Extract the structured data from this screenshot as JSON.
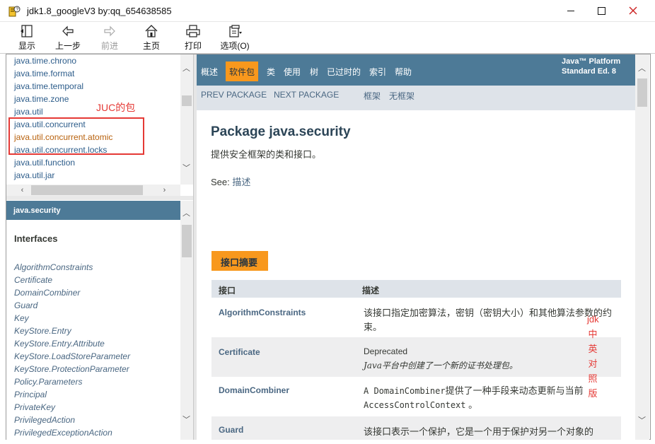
{
  "window": {
    "title": "jdk1.8_googleV3 by:qq_654638585",
    "icon": "chm-help-icon",
    "controls": {
      "minimize": "—",
      "maximize": "☐",
      "close": "✕"
    },
    "close_color": "#cc2222"
  },
  "toolbar": {
    "buttons": [
      {
        "label": "显示",
        "icon": "show-nav-icon",
        "enabled": true
      },
      {
        "label": "上一步",
        "icon": "back-arrow-icon",
        "enabled": true
      },
      {
        "label": "前进",
        "icon": "forward-arrow-icon",
        "enabled": false
      },
      {
        "label": "主页",
        "icon": "home-icon",
        "enabled": true
      },
      {
        "label": "打印",
        "icon": "printer-icon",
        "enabled": true
      },
      {
        "label": "选项(O)",
        "icon": "options-icon",
        "enabled": true
      }
    ]
  },
  "package_list": {
    "items": [
      "java.time.chrono",
      "java.time.format",
      "java.time.temporal",
      "java.time.zone",
      "java.util",
      "java.util.concurrent",
      "java.util.concurrent.atomic",
      "java.util.concurrent.locks",
      "java.util.function",
      "java.util.jar"
    ],
    "highlighted": [
      "java.util.concurrent.atomic"
    ],
    "annotation": "JUC的包"
  },
  "class_pane": {
    "header": "java.security",
    "section": "Interfaces",
    "items": [
      "AlgorithmConstraints",
      "Certificate",
      "DomainCombiner",
      "Guard",
      "Key",
      "KeyStore.Entry",
      "KeyStore.Entry.Attribute",
      "KeyStore.LoadStoreParameter",
      "KeyStore.ProtectionParameter",
      "Policy.Parameters",
      "Principal",
      "PrivateKey",
      "PrivilegedAction",
      "PrivilegedExceptionAction"
    ]
  },
  "content": {
    "top_nav": [
      "概述",
      "软件包",
      "类",
      "使用",
      "树",
      "已过时的",
      "索引",
      "帮助"
    ],
    "active_nav": "软件包",
    "platform_line1": "Java™ Platform",
    "platform_line2": "Standard Ed. 8",
    "sub_nav": [
      "PREV PACKAGE",
      "NEXT PACKAGE",
      "框架",
      "无框架"
    ],
    "package_title": "Package java.security",
    "package_description": "提供安全框架的类和接口。",
    "see_label": "See: ",
    "see_link": "描述",
    "summary_tab": "接口摘要",
    "table_headers": {
      "interface": "接口",
      "description": "描述"
    },
    "rows": [
      {
        "name": "AlgorithmConstraints",
        "desc_main": "该接口指定加密算法，密钥（密钥大小）和其他算法参数的约束。"
      },
      {
        "name": "Certificate",
        "deprecated": "Deprecated",
        "desc_italic": "Java平台中创建了一个新的证书处理包。"
      },
      {
        "name": "DomainCombiner",
        "desc_pre": "A ",
        "desc_code1": "DomainCombiner",
        "desc_mid": "提供了一种手段来动态更新与当前",
        "desc_code2": "AccessControlContext",
        "desc_post": " 。"
      },
      {
        "name": "Guard",
        "desc_main": "该接口表示一个保护，它是一个用于保护对另一个对象的"
      }
    ],
    "side_annotation": [
      "jdk",
      "中",
      "英",
      "对",
      "照",
      "版"
    ]
  },
  "colors": {
    "nav_bar": "#4d7a97",
    "active_tab": "#f8981d",
    "sub_nav": "#dee3e9",
    "link": "#4a6782",
    "highlight_text": "#b8620e",
    "annotation_red": "#e53935"
  }
}
